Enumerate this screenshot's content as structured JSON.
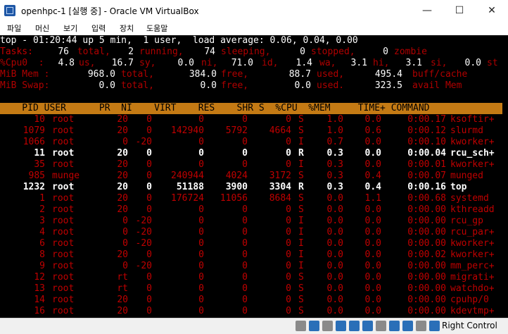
{
  "window": {
    "title": "openhpc-1 [실행 중] - Oracle VM VirtualBox",
    "minimize_glyph": "—",
    "maximize_glyph": "☐",
    "close_glyph": "✕"
  },
  "menu": [
    "파일",
    "머신",
    "보기",
    "입력",
    "장치",
    "도움말"
  ],
  "top_output": {
    "line1": "top - 01:20:44 up 5 min,  1 user,  load average: 0.06, 0.04, 0.00",
    "tasks": {
      "label": "Tasks:",
      "total": "76",
      "running": "2",
      "sleeping": "74",
      "stopped": "0",
      "zombie": "0"
    },
    "cpu": {
      "label": "%Cpu0  :",
      "us": "4.8",
      "sy": "16.7",
      "ni": "0.0",
      "id": "71.0",
      "wa": "1.4",
      "hi": "3.1",
      "si": "3.1",
      "st": "0.0"
    },
    "mem": {
      "label": "MiB Mem :",
      "total": "968.0",
      "free": "384.0",
      "used": "88.7",
      "buff_cache": "495.4"
    },
    "swap": {
      "label": "MiB Swap:",
      "total": "0.0",
      "free": "0.0",
      "used": "0.0",
      "avail": "323.5"
    },
    "header": "    PID USER      PR  NI    VIRT    RES    SHR S  %CPU  %MEM     TIME+ COMMAND",
    "processes": [
      {
        "pid": "10",
        "user": "root",
        "pr": "20",
        "ni": "0",
        "virt": "0",
        "res": "0",
        "shr": "0",
        "s": "S",
        "cpu": "1.0",
        "mem": "0.0",
        "time": "0:00.17",
        "cmd": "ksoftir+",
        "style": "r"
      },
      {
        "pid": "1079",
        "user": "root",
        "pr": "20",
        "ni": "0",
        "virt": "142940",
        "res": "5792",
        "shr": "4664",
        "s": "S",
        "cpu": "1.0",
        "mem": "0.6",
        "time": "0:00.12",
        "cmd": "slurmd",
        "style": "r"
      },
      {
        "pid": "1066",
        "user": "root",
        "pr": "0",
        "ni": "-20",
        "virt": "0",
        "res": "0",
        "shr": "0",
        "s": "I",
        "cpu": "0.7",
        "mem": "0.0",
        "time": "0:00.10",
        "cmd": "kworker+",
        "style": "r"
      },
      {
        "pid": "11",
        "user": "root",
        "pr": "20",
        "ni": "0",
        "virt": "0",
        "res": "0",
        "shr": "0",
        "s": "R",
        "cpu": "0.3",
        "mem": "0.0",
        "time": "0:00.04",
        "cmd": "rcu_sch+",
        "style": "bw"
      },
      {
        "pid": "35",
        "user": "root",
        "pr": "20",
        "ni": "0",
        "virt": "0",
        "res": "0",
        "shr": "0",
        "s": "I",
        "cpu": "0.3",
        "mem": "0.0",
        "time": "0:00.01",
        "cmd": "kworker+",
        "style": "r"
      },
      {
        "pid": "985",
        "user": "munge",
        "pr": "20",
        "ni": "0",
        "virt": "240944",
        "res": "4024",
        "shr": "3172",
        "s": "S",
        "cpu": "0.3",
        "mem": "0.4",
        "time": "0:00.07",
        "cmd": "munged",
        "style": "r"
      },
      {
        "pid": "1232",
        "user": "root",
        "pr": "20",
        "ni": "0",
        "virt": "51188",
        "res": "3900",
        "shr": "3304",
        "s": "R",
        "cpu": "0.3",
        "mem": "0.4",
        "time": "0:00.16",
        "cmd": "top",
        "style": "bw"
      },
      {
        "pid": "1",
        "user": "root",
        "pr": "20",
        "ni": "0",
        "virt": "176724",
        "res": "11056",
        "shr": "8684",
        "s": "S",
        "cpu": "0.0",
        "mem": "1.1",
        "time": "0:00.68",
        "cmd": "systemd",
        "style": "r"
      },
      {
        "pid": "2",
        "user": "root",
        "pr": "20",
        "ni": "0",
        "virt": "0",
        "res": "0",
        "shr": "0",
        "s": "S",
        "cpu": "0.0",
        "mem": "0.0",
        "time": "0:00.00",
        "cmd": "kthreadd",
        "style": "r"
      },
      {
        "pid": "3",
        "user": "root",
        "pr": "0",
        "ni": "-20",
        "virt": "0",
        "res": "0",
        "shr": "0",
        "s": "I",
        "cpu": "0.0",
        "mem": "0.0",
        "time": "0:00.00",
        "cmd": "rcu_gp",
        "style": "r"
      },
      {
        "pid": "4",
        "user": "root",
        "pr": "0",
        "ni": "-20",
        "virt": "0",
        "res": "0",
        "shr": "0",
        "s": "I",
        "cpu": "0.0",
        "mem": "0.0",
        "time": "0:00.00",
        "cmd": "rcu_par+",
        "style": "r"
      },
      {
        "pid": "6",
        "user": "root",
        "pr": "0",
        "ni": "-20",
        "virt": "0",
        "res": "0",
        "shr": "0",
        "s": "I",
        "cpu": "0.0",
        "mem": "0.0",
        "time": "0:00.00",
        "cmd": "kworker+",
        "style": "r"
      },
      {
        "pid": "8",
        "user": "root",
        "pr": "20",
        "ni": "0",
        "virt": "0",
        "res": "0",
        "shr": "0",
        "s": "I",
        "cpu": "0.0",
        "mem": "0.0",
        "time": "0:00.02",
        "cmd": "kworker+",
        "style": "r"
      },
      {
        "pid": "9",
        "user": "root",
        "pr": "0",
        "ni": "-20",
        "virt": "0",
        "res": "0",
        "shr": "0",
        "s": "I",
        "cpu": "0.0",
        "mem": "0.0",
        "time": "0:00.00",
        "cmd": "mm_perc+",
        "style": "r"
      },
      {
        "pid": "12",
        "user": "root",
        "pr": "rt",
        "ni": "0",
        "virt": "0",
        "res": "0",
        "shr": "0",
        "s": "S",
        "cpu": "0.0",
        "mem": "0.0",
        "time": "0:00.00",
        "cmd": "migrati+",
        "style": "r"
      },
      {
        "pid": "13",
        "user": "root",
        "pr": "rt",
        "ni": "0",
        "virt": "0",
        "res": "0",
        "shr": "0",
        "s": "S",
        "cpu": "0.0",
        "mem": "0.0",
        "time": "0:00.00",
        "cmd": "watchdo+",
        "style": "r"
      },
      {
        "pid": "14",
        "user": "root",
        "pr": "20",
        "ni": "0",
        "virt": "0",
        "res": "0",
        "shr": "0",
        "s": "S",
        "cpu": "0.0",
        "mem": "0.0",
        "time": "0:00.00",
        "cmd": "cpuhp/0",
        "style": "r"
      },
      {
        "pid": "16",
        "user": "root",
        "pr": "20",
        "ni": "0",
        "virt": "0",
        "res": "0",
        "shr": "0",
        "s": "S",
        "cpu": "0.0",
        "mem": "0.0",
        "time": "0:00.00",
        "cmd": "kdevtmp+",
        "style": "r"
      }
    ]
  },
  "statusbar": {
    "icons": [
      "hard-disk-icon",
      "optical-drive-icon",
      "audio-icon",
      "network-icon",
      "usb-icon",
      "shared-folder-icon",
      "display-icon",
      "video-capture-icon",
      "cpu-icon",
      "mouse-integration-icon",
      "arrow-down-icon"
    ],
    "host_key": "Right Control",
    "colors": {
      "icon_blue": "#2a6fb8",
      "icon_gray": "#8a8a8a",
      "icon_green": "#3a9a3a"
    }
  }
}
